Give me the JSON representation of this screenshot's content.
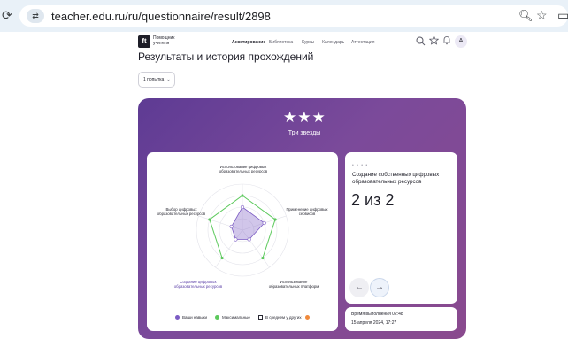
{
  "browser": {
    "url": "teacher.edu.ru/ru/questionnaire/result/2898",
    "back_glyph": "⟳",
    "site_info_glyph": "⇄",
    "zoom_glyph": "🔍︎",
    "star_glyph": "☆",
    "ext_glyph": "▭"
  },
  "header": {
    "logo_glyph": "ft",
    "logo_text": "Помощник учителя",
    "nav": [
      "Анкетирование",
      "Библиотека",
      "Курсы",
      "Календарь",
      "Аттестация"
    ],
    "avatar": "A"
  },
  "page": {
    "title": "Результаты и история прохождений",
    "attempt_select": "1 попытка",
    "attempt_chevron": "⌄"
  },
  "result": {
    "stars": "★★★",
    "stars_label": "Три звезды",
    "radar": {
      "axes": [
        "Использование цифровых образовательных ресурсов",
        "Применение цифровых сервисов",
        "Использование образовательных платформ",
        "Создание цифровых образовательных ресурсов",
        "Выбор цифровых образовательных ресурсов"
      ],
      "your_skills": [
        2,
        2,
        1,
        1,
        1
      ],
      "maximum": [
        3,
        3,
        3,
        3,
        3
      ],
      "scale_max": 4,
      "colors": {
        "your": "#7c5cc4",
        "max": "#5cc95c",
        "avg": "#f08a3c"
      }
    },
    "legend": {
      "your": "Ваши навыки",
      "max": "Максимальные",
      "avg": "В среднем у других"
    },
    "skill": {
      "dots": "• • • •",
      "name": "Создание собственных цифровых образовательных ресурсов",
      "score": "2 из 2",
      "prev_glyph": "←",
      "next_glyph": "→"
    },
    "time": {
      "duration": "Время выполнения 02:48",
      "date": "15 апреля 2024, 17:27"
    }
  }
}
